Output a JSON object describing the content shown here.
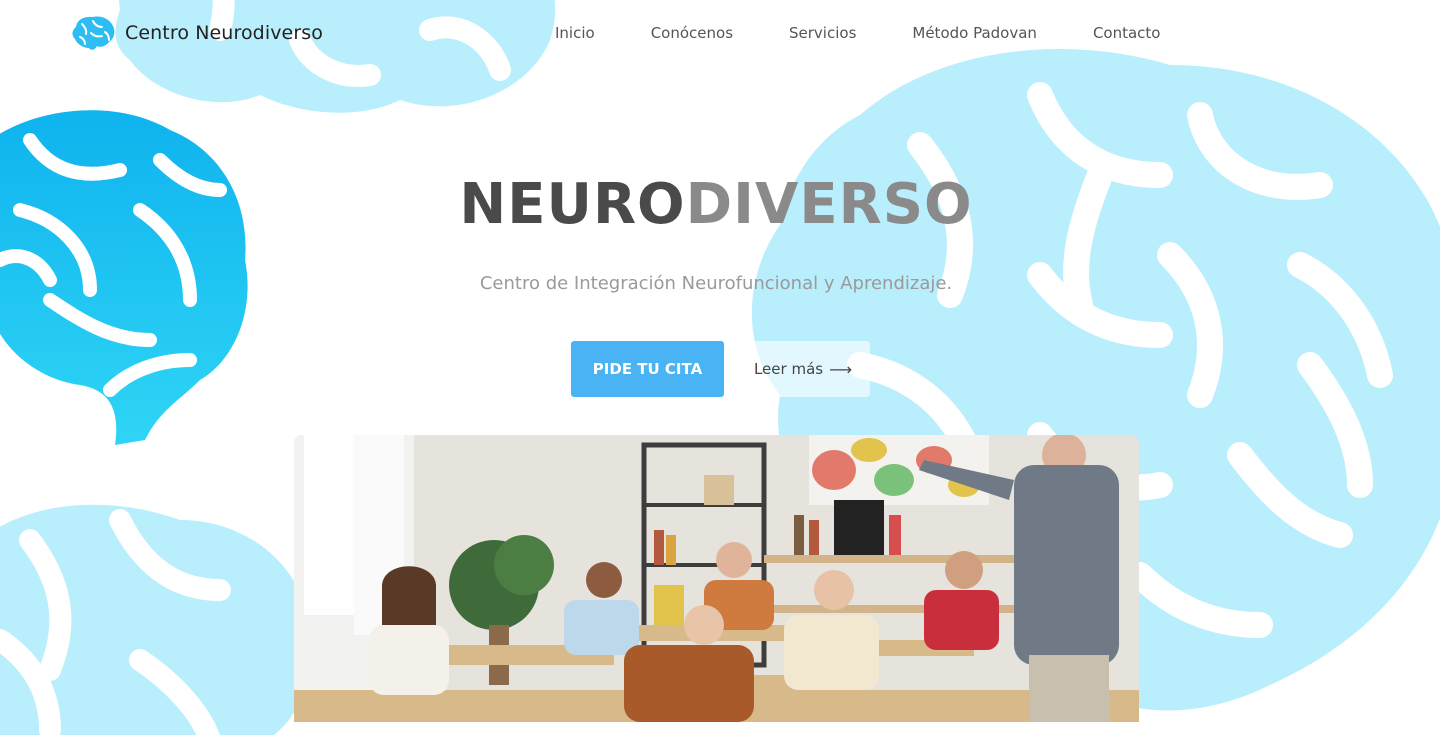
{
  "brand": {
    "name": "Centro Neurodiverso",
    "icon": "brain-icon",
    "accent": "#4ab3f4",
    "brain_blue": "#17b8f0",
    "brain_light": "#b9eefc"
  },
  "nav": {
    "items": [
      {
        "label": "Inicio"
      },
      {
        "label": "Conócenos"
      },
      {
        "label": "Servicios"
      },
      {
        "label": "Método Padovan"
      },
      {
        "label": "Contacto"
      }
    ]
  },
  "hero": {
    "title_part1": "NEURO",
    "title_part2": "DIVERSO",
    "subtitle": "Centro de Integración Neurofuncional y Aprendizaje.",
    "cta_label": "PIDE TU CITA",
    "more_label": "Leer más",
    "more_icon": "arrow-right-icon",
    "image": "classroom-photo"
  }
}
